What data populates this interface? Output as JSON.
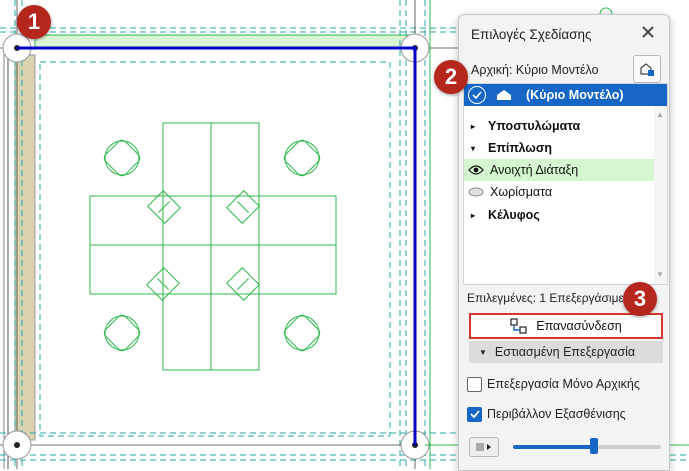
{
  "badges": {
    "one": "1",
    "two": "2",
    "three": "3"
  },
  "panel": {
    "title": "Επιλογές Σχεδίασης",
    "source_label": "Αρχική: Κύριο Μοντέλο",
    "tree": [
      {
        "label": "(Κύριο Μοντέλο)",
        "state": "selected"
      },
      {
        "label": "Υποστυλώματα",
        "type": "group"
      },
      {
        "label": "Επίπλωση",
        "type": "group-open"
      },
      {
        "label": "Ανοιχτή Διάταξη",
        "type": "option-active"
      },
      {
        "label": "Χωρίσματα",
        "type": "option"
      },
      {
        "label": "Κέλυφος",
        "type": "group"
      }
    ],
    "selected_count": "Επιλεγμένες: 1 Επεξεργάσιμες",
    "relink_label": "Επανασύνδεση",
    "focus_label": "Εστιασμένη Επεξεργασία",
    "edit_original_only": "Επεξεργασία Μόνο Αρχικής",
    "edit_original_checked": false,
    "fade_environment": "Περιβάλλον Εξασθένισης",
    "fade_environment_checked": true,
    "fade_level": 0.55
  },
  "colors": {
    "accent": "#1666c5",
    "badge": "#b5261d",
    "wall": "#0000cc",
    "furniture": "#2db84a",
    "highlight": "#d5f7d0",
    "relink_border": "#d9362b"
  },
  "icons": [
    "close-icon",
    "source-settings-icon",
    "checkmark-icon",
    "house-icon",
    "eye-icon",
    "eye-closed-icon",
    "relink-icon",
    "caret-down-icon",
    "checkbox-check-icon",
    "color-swatch-icon"
  ]
}
